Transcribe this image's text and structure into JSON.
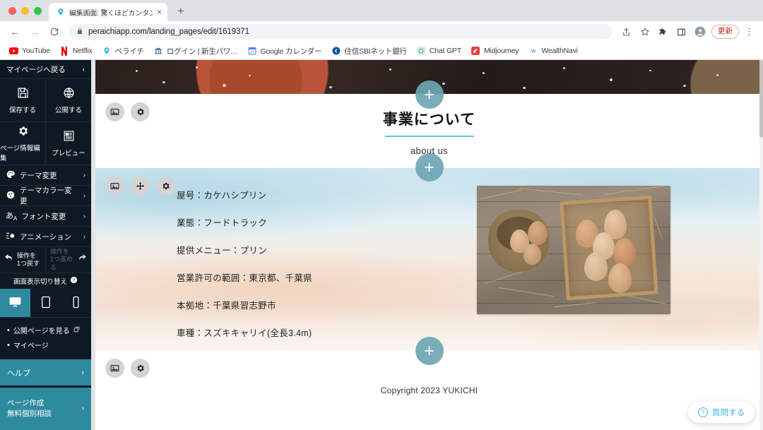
{
  "browser": {
    "tab": {
      "title": "編集画面: 驚くほどカンタン！無料",
      "favicon": "peraichi-icon",
      "close": "×"
    },
    "new_tab_label": "+",
    "nav": {
      "back": "←",
      "forward": "→",
      "reload": "C"
    },
    "omnibox": {
      "url": "peraichiapp.com/landing_pages/edit/1619371",
      "lock": "lock-icon"
    },
    "toolbar_icons": [
      "share-icon",
      "bookmark-star-icon",
      "extensions-puzzle-icon",
      "side-panel-icon",
      "profile-avatar-icon"
    ],
    "update_button": "更新",
    "menu": "⋮",
    "bookmarks": [
      {
        "label": "YouTube",
        "icon": "youtube-icon"
      },
      {
        "label": "Netflix",
        "icon": "netflix-icon"
      },
      {
        "label": "ペライチ",
        "icon": "peraichi-icon"
      },
      {
        "label": "ログイン | 新生パワ…",
        "icon": "bank-icon"
      },
      {
        "label": "Google カレンダー",
        "icon": "google-calendar-icon"
      },
      {
        "label": "住信SBIネット銀行",
        "icon": "sbi-icon"
      },
      {
        "label": "Chat GPT",
        "icon": "chatgpt-icon"
      },
      {
        "label": "Midjourney",
        "icon": "midjourney-icon"
      },
      {
        "label": "WealthNavi",
        "icon": "wealthnavi-icon"
      }
    ]
  },
  "sidebar": {
    "back_label": "マイページへ戻る",
    "collapse_icon": "chevron-left-icon",
    "actions": [
      {
        "label": "保存する",
        "icon": "save-floppy-icon"
      },
      {
        "label": "公開する",
        "icon": "publish-globe-icon"
      },
      {
        "label": "ページ情報編集",
        "icon": "gear-icon"
      },
      {
        "label": "プレビュー",
        "icon": "preview-document-icon"
      }
    ],
    "menu_rows": [
      {
        "label": "テーマ変更",
        "icon": "palette-icon",
        "chevron": "›"
      },
      {
        "label": "テーマカラー変更",
        "icon": "color-wheel-icon",
        "chevron": "›"
      },
      {
        "label": "フォント変更",
        "icon": "font-icon",
        "chevron": "›"
      },
      {
        "label": "アニメーション",
        "icon": "animation-icon",
        "chevron": "›"
      }
    ],
    "undo": {
      "line1": "操作を",
      "line2": "1つ戻す",
      "icon": "undo-arrow-icon"
    },
    "redo": {
      "line1": "操作を",
      "line2": "1つ進める",
      "icon": "redo-arrow-icon"
    },
    "view_switch_label": "画面表示切り替え",
    "view_switch_help_icon": "help-circle-icon",
    "devices": [
      {
        "name": "desktop",
        "icon": "desktop-icon",
        "active": true
      },
      {
        "name": "tablet",
        "icon": "tablet-icon",
        "active": false
      },
      {
        "name": "mobile",
        "icon": "mobile-icon",
        "active": false
      }
    ],
    "links": [
      {
        "label": "公開ページを見る",
        "icon": "external-link-icon"
      },
      {
        "label": "マイページ",
        "icon": ""
      }
    ],
    "help": {
      "label": "ヘルプ",
      "chevron": "›"
    },
    "promo": {
      "line1": "ページ作成",
      "line2": "無料個別相談",
      "chevron": "›"
    }
  },
  "canvas": {
    "hero": {
      "alt": "dark-terracotta-bowl-photo"
    },
    "edit_buttons": {
      "image": "image-icon",
      "move": "move-arrows-icon",
      "settings": "gear-icon"
    },
    "section": {
      "title": "事業について",
      "subtitle": "about us"
    },
    "about_lines": [
      "屋号：カケハシプリン",
      "業態：フードトラック",
      "提供メニュー：プリン",
      "営業許可の範囲：東京都、千葉県",
      "本拠地：千葉県習志野市",
      "車種：スズキキャリイ(全長3.4m)"
    ],
    "about_image_alt": "eggs-in-burlap-sack-and-wooden-crate-photo",
    "copyright": "Copyright 2023 YUKICHI",
    "add_button_label": "+",
    "help_bubble": {
      "label": "質問する",
      "icon": "question-mark-icon"
    }
  },
  "colors": {
    "sidebar_bg": "#0f1923",
    "accent_teal": "#2e8a9e",
    "plus_button": "#6fa5b4",
    "title_rule": "#5bc8dd",
    "help_text": "#3fb7dd",
    "update_red": "#c5221f"
  }
}
